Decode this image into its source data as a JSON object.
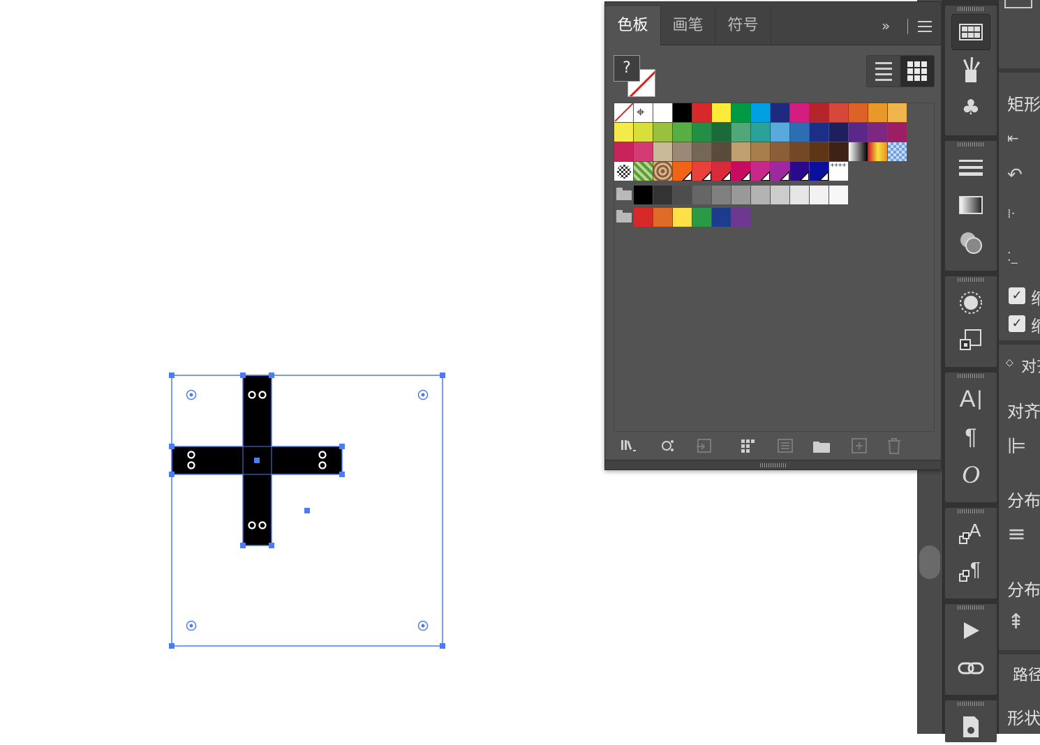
{
  "swatches_panel": {
    "tabs": [
      {
        "label": "色板",
        "active": true
      },
      {
        "label": "画笔",
        "active": false
      },
      {
        "label": "符号",
        "active": false
      }
    ],
    "more_label": "»",
    "fill_label": "?",
    "view_mode": "grid",
    "rows": [
      [
        {
          "kind": "none"
        },
        {
          "kind": "registration"
        },
        {
          "color": "#ffffff"
        },
        {
          "color": "#000000"
        },
        {
          "color": "#d7282a"
        },
        {
          "color": "#fcec39"
        },
        {
          "color": "#009a44"
        },
        {
          "color": "#00a0e3"
        },
        {
          "color": "#1e2a7e"
        },
        {
          "color": "#d51d7f"
        },
        {
          "color": "#b5232b"
        },
        {
          "color": "#d8483a"
        },
        {
          "color": "#dd6228"
        },
        {
          "color": "#e8992a"
        },
        {
          "color": "#f0b44c"
        }
      ],
      [
        {
          "color": "#f5ea4c"
        },
        {
          "color": "#d8df3a"
        },
        {
          "color": "#9ac040"
        },
        {
          "color": "#58ae45"
        },
        {
          "color": "#238f46"
        },
        {
          "color": "#1b6a3a"
        },
        {
          "color": "#52a77a"
        },
        {
          "color": "#2aa29a"
        },
        {
          "color": "#58aadd"
        },
        {
          "color": "#2c6db4"
        },
        {
          "color": "#1c2f86"
        },
        {
          "color": "#201f5e"
        },
        {
          "color": "#5a2888"
        },
        {
          "color": "#7d2783"
        },
        {
          "color": "#9c1f66"
        }
      ],
      [
        {
          "color": "#c8245a"
        },
        {
          "color": "#d43a73"
        },
        {
          "color": "#c8b99a"
        },
        {
          "color": "#9b8877"
        },
        {
          "color": "#756755"
        },
        {
          "color": "#5b4b3d"
        },
        {
          "color": "#c0a070"
        },
        {
          "color": "#a67e4c"
        },
        {
          "color": "#8d5f38"
        },
        {
          "color": "#744725"
        },
        {
          "color": "#5e3515"
        },
        {
          "color": "#3e2213"
        },
        {
          "kind": "grad-bw"
        },
        {
          "kind": "grad-rb"
        },
        {
          "kind": "grad-blue"
        }
      ],
      [
        {
          "kind": "pat-dots"
        },
        {
          "kind": "pat-leaf"
        },
        {
          "kind": "pat-swirl"
        },
        {
          "color": "#f06418",
          "kind": "dual"
        },
        {
          "color": "#e8403a",
          "kind": "dual"
        },
        {
          "color": "#d92a3a",
          "kind": "dual"
        },
        {
          "color": "#c80a60",
          "kind": "dual"
        },
        {
          "color": "#c8288a",
          "kind": "dual"
        },
        {
          "color": "#a0289e",
          "kind": "dual"
        },
        {
          "color": "#2a0a8a",
          "kind": "dual"
        },
        {
          "color": "#0a109a",
          "kind": "dual"
        },
        {
          "kind": "pat-plus"
        }
      ],
      [
        {
          "kind": "folder"
        },
        {
          "color": "#000000"
        },
        {
          "color": "#333333"
        },
        {
          "color": "#4d4d4d"
        },
        {
          "color": "#666666"
        },
        {
          "color": "#808080"
        },
        {
          "color": "#999999"
        },
        {
          "color": "#b3b3b3"
        },
        {
          "color": "#cccccc"
        },
        {
          "color": "#e6e6e6"
        },
        {
          "color": "#f2f2f2"
        },
        {
          "color": "#f7f7f7"
        }
      ],
      [
        {
          "kind": "folder"
        },
        {
          "color": "#d7282a"
        },
        {
          "color": "#e06a28"
        },
        {
          "color": "#fde047"
        },
        {
          "color": "#2a9a46"
        },
        {
          "color": "#1e3c8e"
        },
        {
          "color": "#6e3790"
        }
      ]
    ],
    "footer_icons": [
      "library-menu-icon",
      "show-kinds-icon",
      "swatch-options-icon",
      "group-icon",
      "list-icon",
      "new-folder-icon",
      "new-swatch-icon",
      "delete-icon"
    ]
  },
  "icon_dock": {
    "buttons": [
      "swatches-icon",
      "brushes-icon",
      "symbols-icon",
      "stroke-icon",
      "gradient-icon",
      "transparency-icon",
      "appearance-icon",
      "transform-icon",
      "character-icon",
      "paragraph-icon",
      "opentype-icon",
      "character-styles-icon",
      "paragraph-styles-icon",
      "actions-icon",
      "links-icon",
      "document-info-icon"
    ]
  },
  "properties_panel": {
    "rect_label": "矩形",
    "align_header": "对齐",
    "align_label": "对齐",
    "distribute_label_1": "分布",
    "distribute_label_2": "分布",
    "pathfinder_label": "路径",
    "shape_label": "形状",
    "check_1_label": "缩",
    "check_2_label": "缩"
  },
  "colors": {
    "selection": "#4a7cf6",
    "panel_bg": "#535353",
    "dock_bg": "#323232"
  }
}
